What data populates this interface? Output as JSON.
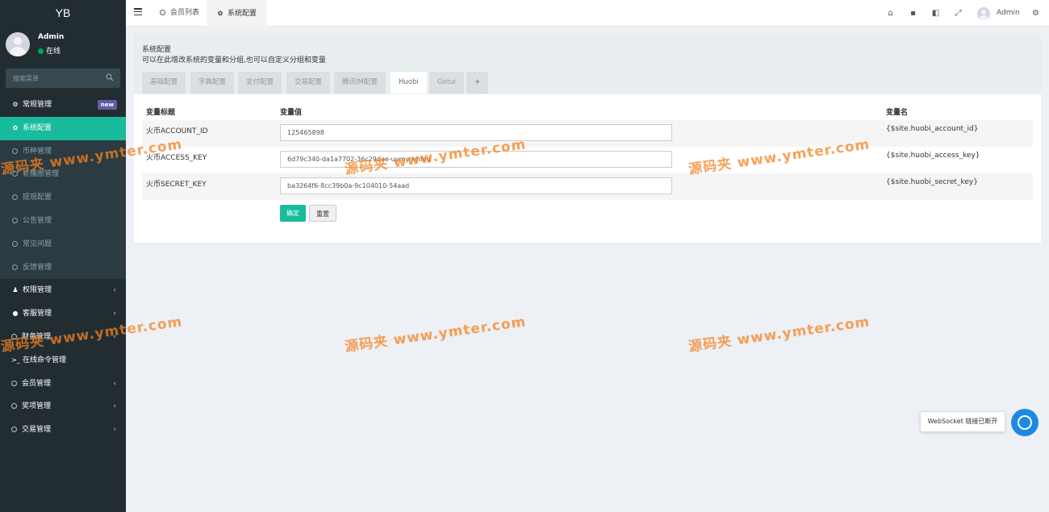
{
  "brand": "YB",
  "user": {
    "name": "Admin",
    "status": "在线"
  },
  "search": {
    "placeholder": "搜索菜单"
  },
  "menu": [
    {
      "label": "常规管理",
      "type": "header",
      "icon": "cogs-icon",
      "badge": "new"
    },
    {
      "label": "系统配置",
      "type": "active",
      "icon": "gear-icon"
    },
    {
      "label": "币种管理",
      "type": "sub"
    },
    {
      "label": "轮播图管理",
      "type": "sub"
    },
    {
      "label": "提现配置",
      "type": "sub"
    },
    {
      "label": "公告管理",
      "type": "sub"
    },
    {
      "label": "常见问题",
      "type": "sub"
    },
    {
      "label": "反馈管理",
      "type": "sub"
    },
    {
      "label": "权限管理",
      "type": "header",
      "icon": "users-icon",
      "chevron": true
    },
    {
      "label": "客服管理",
      "type": "header",
      "icon": "comment-icon",
      "chevron": true
    },
    {
      "label": "财务管理",
      "type": "header",
      "icon": "circle-icon",
      "chevron": true
    },
    {
      "label": "在线命令管理",
      "type": "header",
      "icon": "terminal-icon"
    },
    {
      "label": "会员管理",
      "type": "header",
      "icon": "circle-icon",
      "chevron": true
    },
    {
      "label": "奖项管理",
      "type": "header",
      "icon": "circle-icon",
      "chevron": true
    },
    {
      "label": "交易管理",
      "type": "header",
      "icon": "circle-icon",
      "chevron": true
    }
  ],
  "header": {
    "tabs": [
      {
        "label": "会员列表",
        "icon": "circle-icon"
      },
      {
        "label": "系统配置",
        "icon": "gear-icon"
      }
    ],
    "user": "Admin",
    "icons": [
      "home-icon",
      "trash-icon",
      "language-icon",
      "fullscreen-icon",
      "settings-icon"
    ]
  },
  "panel": {
    "title": "系统配置",
    "subtitle": "可以在此增改系统的变量和分组,也可以自定义分组和变量",
    "tabs": [
      "基础配置",
      "字典配置",
      "支付配置",
      "交易配置",
      "腾讯IM配置",
      "Huobi",
      "Getui",
      "+"
    ],
    "active_tab": "Huobi"
  },
  "table": {
    "headers": [
      "变量标题",
      "变量值",
      "变量名"
    ],
    "rows": [
      {
        "title": "火币ACCOUNT_ID",
        "value": "125465898",
        "name": "{$site.huobi_account_id}"
      },
      {
        "title": "火币ACCESS_KEY",
        "value": "6d79c340-da1a7702-36c29dae-uymylwhfeg",
        "name": "{$site.huobi_access_key}"
      },
      {
        "title": "火币SECRET_KEY",
        "value": "ba3264f6-8cc39b0a-9c104010-54aad",
        "name": "{$site.huobi_secret_key}"
      }
    ]
  },
  "buttons": {
    "ok": "确定",
    "reset": "重置"
  },
  "watermark": "源码夹 www.ymter.com",
  "websocket": {
    "message": "WebSocket 链接已断开"
  },
  "colors": {
    "sidebar": "#222d32",
    "accent": "#18bc9c",
    "badge": "#605ca8"
  }
}
